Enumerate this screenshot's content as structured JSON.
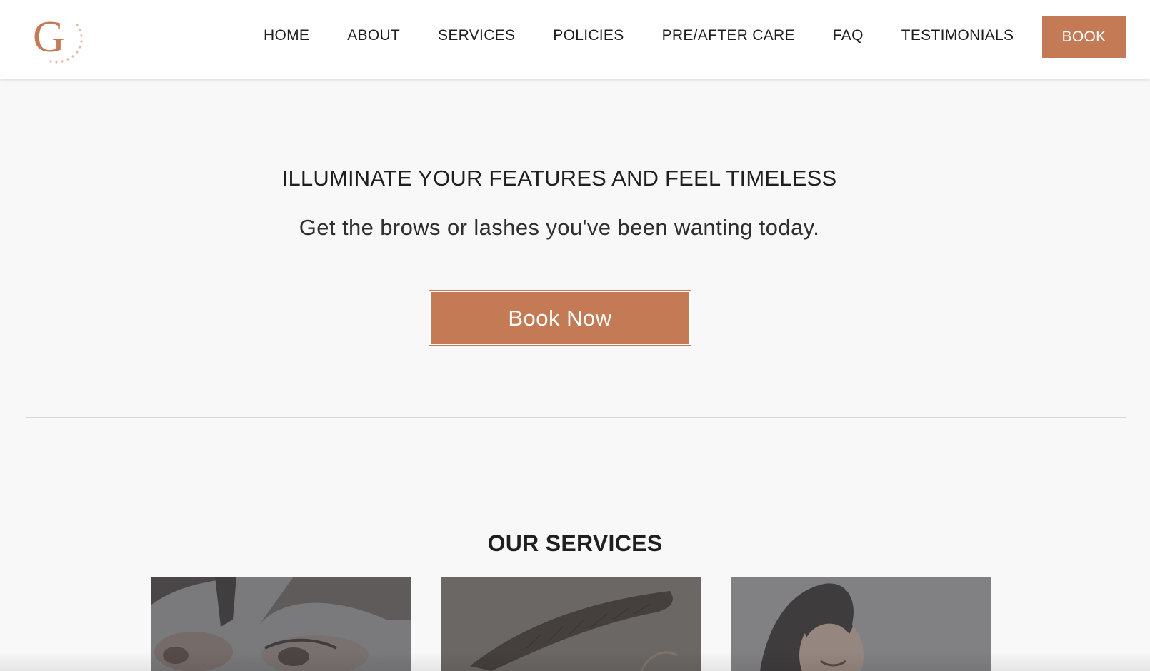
{
  "brand": {
    "logo_letter": "G",
    "accent_color": "#c47b55"
  },
  "nav": {
    "items": [
      {
        "label": "HOME"
      },
      {
        "label": "ABOUT"
      },
      {
        "label": "SERVICES"
      },
      {
        "label": "POLICIES"
      },
      {
        "label": "PRE/AFTER CARE"
      },
      {
        "label": "FAQ"
      },
      {
        "label": "TESTIMONIALS"
      }
    ],
    "book_label": "BOOK"
  },
  "hero": {
    "title": "ILLUMINATE YOUR FEATURES AND FEEL TIMELESS",
    "subtitle": "Get the brows or lashes you've been wanting today.",
    "cta_label": "Book Now"
  },
  "services": {
    "title": "OUR SERVICES",
    "cards": [
      {
        "image": "lash-closeup-image"
      },
      {
        "image": "brow-closeup-image"
      },
      {
        "image": "smiling-woman-image"
      }
    ]
  }
}
